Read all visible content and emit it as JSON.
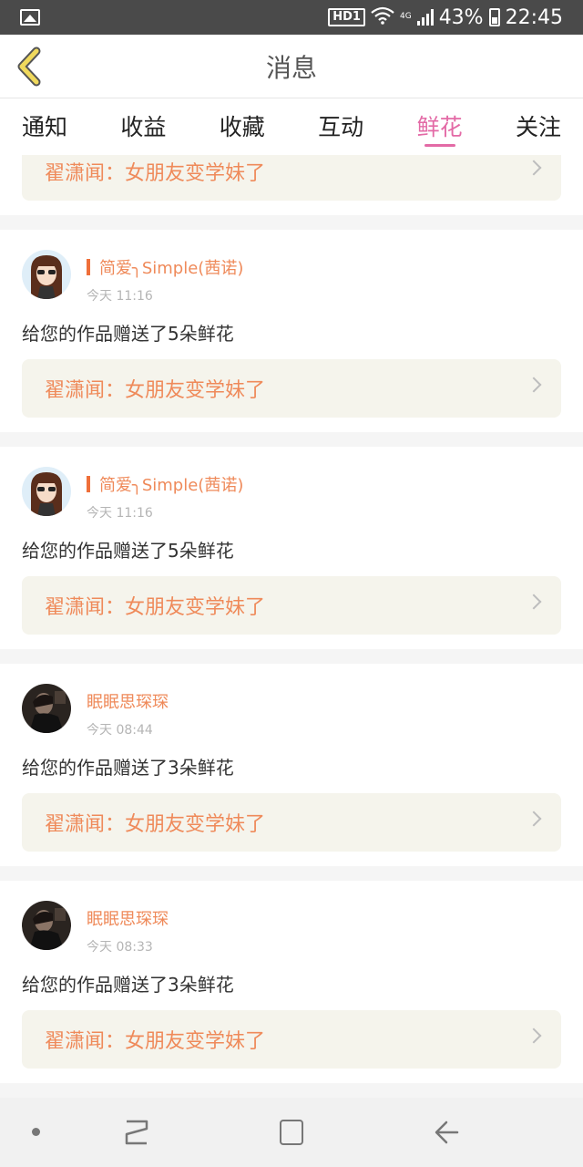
{
  "status_bar": {
    "hd_label": "HD1",
    "network_label": "4G",
    "battery": "43%",
    "time": "22:45",
    "icons": [
      "image-icon",
      "wifi-icon",
      "signal-icon",
      "battery-icon"
    ]
  },
  "header": {
    "title": "消息",
    "back_icon": "back-arrow-icon",
    "accent": "#f0d95c"
  },
  "tabs": [
    {
      "label": "通知",
      "active": false
    },
    {
      "label": "收益",
      "active": false
    },
    {
      "label": "收藏",
      "active": false
    },
    {
      "label": "互动",
      "active": false
    },
    {
      "label": "鲜花",
      "active": true
    },
    {
      "label": "关注",
      "active": false
    }
  ],
  "feed": {
    "partial_item": {
      "work_title": "翟潇闻：女朋友变学妹了"
    },
    "items": [
      {
        "username": "简爱╮Simple(茜诺)",
        "badge": true,
        "time": "今天 11:16",
        "message": "给您的作品赠送了5朵鲜花",
        "work_title": "翟潇闻：女朋友变学妹了",
        "avatar": "cartoon-girl"
      },
      {
        "username": "简爱╮Simple(茜诺)",
        "badge": true,
        "time": "今天 11:16",
        "message": "给您的作品赠送了5朵鲜花",
        "work_title": "翟潇闻：女朋友变学妹了",
        "avatar": "cartoon-girl"
      },
      {
        "username": "眠眠思琛琛",
        "badge": false,
        "time": "今天 08:44",
        "message": "给您的作品赠送了3朵鲜花",
        "work_title": "翟潇闻：女朋友变学妹了",
        "avatar": "dark-photo"
      },
      {
        "username": "眠眠思琛琛",
        "badge": false,
        "time": "今天 08:33",
        "message": "给您的作品赠送了3朵鲜花",
        "work_title": "翟潇闻：女朋友变学妹了",
        "avatar": "dark-photo"
      }
    ]
  },
  "colors": {
    "active_tab": "#e36aa6",
    "username": "#ef8a5a",
    "work_bg": "#f5f4ec"
  },
  "nav": {
    "icons": [
      "dot-icon",
      "recent-apps-icon",
      "home-icon",
      "back-icon"
    ]
  }
}
